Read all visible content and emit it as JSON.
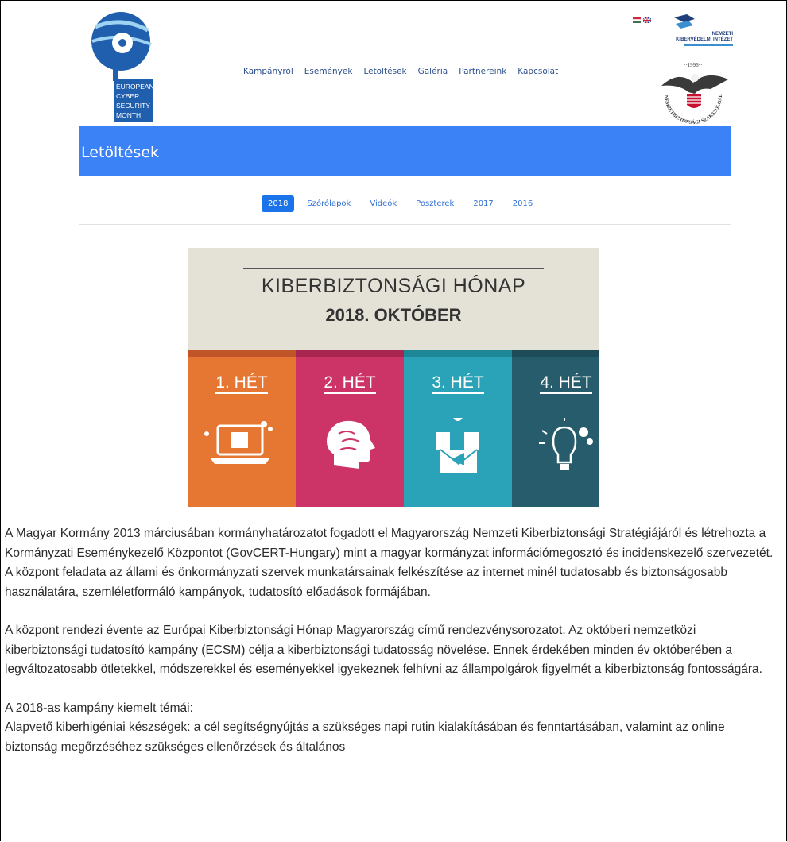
{
  "header": {
    "ecsm_logo_lines": [
      "EUROPEAN",
      "CYBER",
      "SECURITY",
      "MONTH"
    ],
    "nav": [
      "Kampányról",
      "Események",
      "Letöltések",
      "Galéria",
      "Partnereink",
      "Kapcsolat"
    ],
    "nki_logo_lines": [
      "NEMZETI",
      "KIBERVÉDELMI INTÉZET"
    ],
    "seal_year": "1996",
    "seal_text": "NEMZETBIZTONSÁGI SZAKSZOLGÁLAT"
  },
  "banner": {
    "title": "Letöltések",
    "color": "#3b82f6"
  },
  "tabs": [
    "2018",
    "Szórólapok",
    "Videók",
    "Poszterek",
    "2017",
    "2016"
  ],
  "active_tab": "2018",
  "poster": {
    "title": "KIBERBIZTONSÁGI HÓNAP",
    "subtitle": "2018. OKTÓBER",
    "weeks": [
      {
        "label": "1. HÉT",
        "color": "#e57733",
        "top": "#c0552a",
        "icon": "laptop-icon"
      },
      {
        "label": "2. HÉT",
        "color": "#cc3366",
        "top": "#a8254f",
        "icon": "brain-head-icon"
      },
      {
        "label": "3. HÉT",
        "color": "#2aa3b8",
        "top": "#1d8798",
        "icon": "phishing-envelope-icon"
      },
      {
        "label": "4. HÉT",
        "color": "#265c6b",
        "top": "#1e4b58",
        "icon": "lightbulb-gears-icon"
      }
    ]
  },
  "article": {
    "p1": "A Magyar Kormány 2013 márciusában kormányhatározatot fogadott el Magyarország Nemzeti Kiberbiztonsági Stratégiájáról és létrehozta a Kormányzati Eseménykezelő Központot (GovCERT-Hungary) mint a magyar kormányzat információmegosztó és incidenskezelő szervezetét. A központ feladata az állami és önkormányzati szervek munkatársainak felkészítése az internet minél tudatosabb és biztonságosabb használatára, szemléletformáló kampányok, tudatosító előadások formájában.",
    "p2": "A központ rendezi évente az Európai Kiberbiztonsági Hónap Magyarország című rendezvénysorozatot. Az októberi nemzetközi kiberbiztonsági tudatosító kampány (ECSM) célja a kiberbiztonsági tudatosság növelése. Ennek érdekében minden év októberében a legváltozatosabb ötletekkel, módszerekkel és eseményekkel igyekeznek felhívni az állampolgárok figyelmét a kiberbiztonság fontosságára.",
    "p3": "A 2018-as kampány kiemelt témái:",
    "p4": "Alapvető kiberhigéniai készségek: a cél segítségnyújtás a szükséges napi rutin kialakításában és fenntartásában, valamint az online biztonság megőrzéséhez szükséges ellenőrzések és általános"
  }
}
